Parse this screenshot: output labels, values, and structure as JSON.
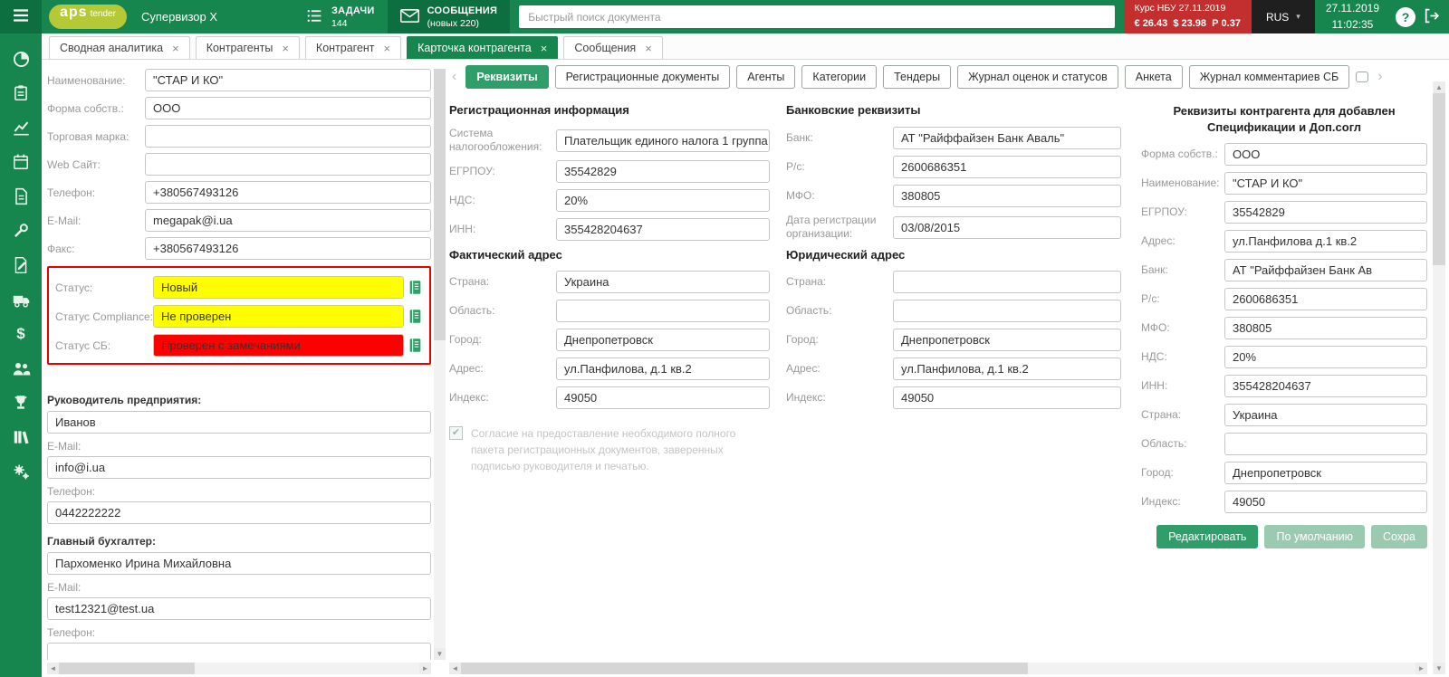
{
  "colors": {
    "green": "#17854e",
    "green_dark": "#0d6e3f",
    "green_bright": "#2f9e68",
    "green_pale": "#9acbb1",
    "logo_yellow": "#b5c836",
    "red_bar": "#c22f2e",
    "dark": "#1f1f1f",
    "status_yellow": "#ffff00",
    "status_red": "#ff0000",
    "alert_border": "#e60000"
  },
  "icons": {
    "close": "×",
    "dropdown": "▾",
    "chevron_left": "‹",
    "chevron_right": "›",
    "scroll_left": "◄",
    "scroll_right": "►",
    "scroll_up": "▲",
    "scroll_down": "▼",
    "help": "?",
    "check": "✔",
    "dollar": "$"
  },
  "header": {
    "logo_primary": "aps",
    "logo_secondary": "tender",
    "title": "Супервизор X",
    "tasks_label": "ЗАДАЧИ",
    "tasks_count": "144",
    "messages_label": "СООБЩЕНИЯ",
    "messages_sub": "(новых 220)",
    "search_placeholder": "Быстрый поиск документа",
    "rate_title": "Курс НБУ 27.11.2019",
    "rate_values": "€ 26.43  $ 23.98  Р 0.37",
    "lang": "RUS",
    "date": "27.11.2019",
    "time": "11:02:35"
  },
  "tabs": [
    {
      "label": "Сводная аналитика",
      "active": false
    },
    {
      "label": "Контрагенты",
      "active": false
    },
    {
      "label": "Контрагент",
      "active": false
    },
    {
      "label": "Карточка контрагента",
      "active": true
    },
    {
      "label": "Сообщения",
      "active": false
    }
  ],
  "left_form": {
    "fields": [
      {
        "label": "Наименование:",
        "value": "\"СТАР И КО\""
      },
      {
        "label": "Форма собств.:",
        "value": "ООО"
      },
      {
        "label": "Торговая марка:",
        "value": ""
      },
      {
        "label": "Web Сайт:",
        "value": ""
      },
      {
        "label": "Телефон:",
        "value": "+380567493126"
      },
      {
        "label": "E-Mail:",
        "value": "megapak@i.ua"
      },
      {
        "label": "Факс:",
        "value": "+380567493126"
      }
    ],
    "status": [
      {
        "label": "Статус:",
        "value": "Новый"
      },
      {
        "label": "Статус Compliance:",
        "value": "Не проверен"
      },
      {
        "label": "Статус СБ:",
        "value": "Проверен с замечаниями"
      }
    ],
    "director": {
      "title": "Руководитель предприятия:",
      "name": "Иванов",
      "email_label": "E-Mail:",
      "email": "info@i.ua",
      "phone_label": "Телефон:",
      "phone": "0442222222"
    },
    "accountant": {
      "title": "Главный бухгалтер:",
      "name": "Пархоменко Ирина Михайловна",
      "email_label": "E-Mail:",
      "email": "test12321@test.ua",
      "phone_label": "Телефон:",
      "phone": ""
    }
  },
  "detail_tabs": [
    {
      "label": "Реквизиты",
      "active": true
    },
    {
      "label": "Регистрационные документы",
      "active": false
    },
    {
      "label": "Агенты",
      "active": false
    },
    {
      "label": "Категории",
      "active": false
    },
    {
      "label": "Тендеры",
      "active": false
    },
    {
      "label": "Журнал оценок и статусов",
      "active": false
    },
    {
      "label": "Анкета",
      "active": false
    },
    {
      "label": "Журнал комментариев СБ",
      "active": false
    }
  ],
  "reg": {
    "title": "Регистрационная информация",
    "fields": [
      {
        "label": "Система налогообложения:",
        "value": "Плательщик единого налога 1 группа"
      },
      {
        "label": "ЕГРПОУ:",
        "value": "35542829"
      },
      {
        "label": "НДС:",
        "value": "20%"
      },
      {
        "label": "ИНН:",
        "value": "355428204637"
      }
    ],
    "addr_title": "Фактический адрес",
    "addr": [
      {
        "label": "Страна:",
        "value": "Украина"
      },
      {
        "label": "Область:",
        "value": ""
      },
      {
        "label": "Город:",
        "value": "Днепропетровск"
      },
      {
        "label": "Адрес:",
        "value": "ул.Панфилова, д.1 кв.2"
      },
      {
        "label": "Индекс:",
        "value": "49050"
      }
    ],
    "consent": "Согласие на предоставление необходимого полного пакета регистрационных документов, заверенных подписью руководителя и печатью."
  },
  "bank": {
    "title": "Банковские реквизиты",
    "fields": [
      {
        "label": "Банк:",
        "value": "АТ \"Райффайзен Банк Аваль\""
      },
      {
        "label": "Р/с:",
        "value": "2600686351"
      },
      {
        "label": "МФО:",
        "value": "380805"
      },
      {
        "label": "Дата регистрации организации:",
        "value": "03/08/2015"
      }
    ],
    "addr_title": "Юридический адрес",
    "addr": [
      {
        "label": "Страна:",
        "value": ""
      },
      {
        "label": "Область:",
        "value": ""
      },
      {
        "label": "Город:",
        "value": "Днепропетровск"
      },
      {
        "label": "Адрес:",
        "value": "ул.Панфилова, д.1 кв.2"
      },
      {
        "label": "Индекс:",
        "value": "49050"
      }
    ]
  },
  "spec": {
    "title_line1": "Реквизиты контрагента для добавлен",
    "title_line2": "Спецификации и Доп.согл",
    "fields": [
      {
        "label": "Форма собств.:",
        "value": "ООО"
      },
      {
        "label": "Наименование:",
        "value": "\"СТАР И КО\""
      },
      {
        "label": "ЕГРПОУ:",
        "value": "35542829"
      },
      {
        "label": "Адрес:",
        "value": "ул.Панфилова д.1 кв.2"
      },
      {
        "label": "Банк:",
        "value": "АТ \"Райффайзен Банк Ав"
      },
      {
        "label": "Р/с:",
        "value": "2600686351"
      },
      {
        "label": "МФО:",
        "value": "380805"
      },
      {
        "label": "НДС:",
        "value": "20%"
      },
      {
        "label": "ИНН:",
        "value": "355428204637"
      },
      {
        "label": "Страна:",
        "value": "Украина"
      },
      {
        "label": "Область:",
        "value": ""
      },
      {
        "label": "Город:",
        "value": "Днепропетровск"
      },
      {
        "label": "Индекс:",
        "value": "49050"
      }
    ],
    "buttons": [
      {
        "label": "Редактировать"
      },
      {
        "label": "По умолчанию"
      },
      {
        "label": "Сохра"
      }
    ]
  }
}
